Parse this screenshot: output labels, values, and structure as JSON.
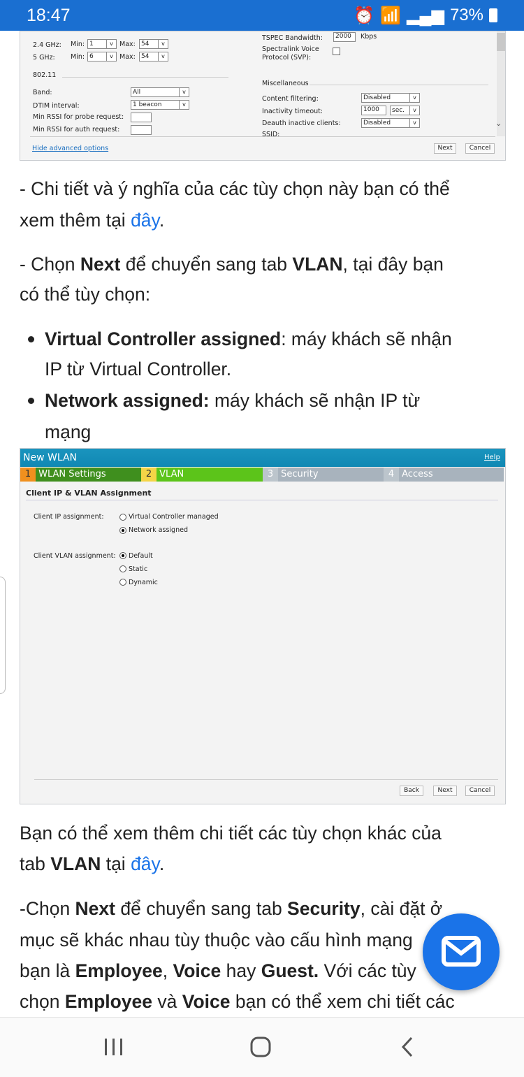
{
  "status_bar": {
    "time": "18:47",
    "battery": "73%"
  },
  "shot1": {
    "rates": [
      {
        "band": "2.4 GHz:",
        "min_label": "Min:",
        "min": "1",
        "max_label": "Max:",
        "max": "54"
      },
      {
        "band": "5 GHz:",
        "min_label": "Min:",
        "min": "6",
        "max_label": "Max:",
        "max": "54"
      }
    ],
    "section_80211": "802.11",
    "band_label": "Band:",
    "band_value": "All",
    "dtim_label": "DTIM interval:",
    "dtim_value": "1 beacon",
    "rssi_probe_label": "Min RSSI for probe request:",
    "rssi_auth_label": "Min RSSI for auth request:",
    "tspec_label": "TSPEC Bandwidth:",
    "tspec_value": "2000",
    "tspec_unit": "Kbps",
    "svp_label_1": "Spectralink Voice",
    "svp_label_2": "Protocol (SVP):",
    "misc": "Miscellaneous",
    "content_filter_label": "Content filtering:",
    "content_filter_value": "Disabled",
    "inactivity_label": "Inactivity timeout:",
    "inactivity_value": "1000",
    "inactivity_unit": "sec.",
    "deauth_label": "Deauth inactive clients:",
    "deauth_value": "Disabled",
    "ssid_label": "SSID:",
    "hide_advanced": "Hide advanced options",
    "next": "Next",
    "cancel": "Cancel"
  },
  "para1": [
    [
      {
        "t": "- Chi tiết và ý nghĩa của các tùy chọn này bạn có thể"
      }
    ],
    [
      {
        "t": "xem thêm tại "
      },
      {
        "t": "đây",
        "link": true
      },
      {
        "t": "."
      }
    ]
  ],
  "para2": [
    [
      {
        "t": "- Chọn "
      },
      {
        "t": "Next",
        "b": true
      },
      {
        "t": " để chuyển sang tab "
      },
      {
        "t": "VLAN",
        "b": true
      },
      {
        "t": ", tại đây bạn"
      }
    ],
    [
      {
        "t": "có thể tùy chọn:"
      }
    ]
  ],
  "bullets": [
    [
      {
        "t": "Virtual Controller assigned",
        "b": true
      },
      {
        "t": ": máy khách sẽ nhận"
      }
    ],
    [
      {
        "t": "IP từ Virtual Controller."
      }
    ],
    [
      {
        "t": "Network assigned:",
        "b": true
      },
      {
        "t": " máy khách sẽ nhận IP từ"
      }
    ],
    [
      {
        "t": "mạng"
      }
    ]
  ],
  "shot2": {
    "title": "New WLAN",
    "help": "Help",
    "tabs": [
      {
        "n": "1",
        "label": "WLAN Settings"
      },
      {
        "n": "2",
        "label": "VLAN"
      },
      {
        "n": "3",
        "label": "Security"
      },
      {
        "n": "4",
        "label": "Access"
      }
    ],
    "heading": "Client IP & VLAN Assignment",
    "ip_label": "Client IP assignment:",
    "ip_options": [
      {
        "label": "Virtual Controller managed",
        "selected": false
      },
      {
        "label": "Network assigned",
        "selected": true
      }
    ],
    "vlan_label": "Client VLAN assignment:",
    "vlan_options": [
      {
        "label": "Default",
        "selected": true
      },
      {
        "label": "Static",
        "selected": false
      },
      {
        "label": "Dynamic",
        "selected": false
      }
    ],
    "back": "Back",
    "next": "Next",
    "cancel": "Cancel"
  },
  "para3": [
    [
      {
        "t": " Bạn có thể xem thêm chi tiết các tùy chọn khác của"
      }
    ],
    [
      {
        "t": "tab "
      },
      {
        "t": "VLAN",
        "b": true
      },
      {
        "t": " tại "
      },
      {
        "t": "đây",
        "link": true
      },
      {
        "t": "."
      }
    ]
  ],
  "para4": [
    [
      {
        "t": "-Chọn "
      },
      {
        "t": "Next",
        "b": true
      },
      {
        "t": " để chuyển sang tab "
      },
      {
        "t": "Security",
        "b": true
      },
      {
        "t": ", cài đặt ở"
      }
    ],
    [
      {
        "t": "mục sẽ khác nhau tùy thuộc vào cấu hình mạng"
      }
    ],
    [
      {
        "t": "bạn là "
      },
      {
        "t": "Employee",
        "b": true
      },
      {
        "t": ", "
      },
      {
        "t": "Voice",
        "b": true
      },
      {
        "t": " hay "
      },
      {
        "t": "Guest.",
        "b": true
      },
      {
        "t": " Với các tùy"
      }
    ],
    [
      {
        "t": "chọn "
      },
      {
        "t": "Employee",
        "b": true
      },
      {
        "t": " và "
      },
      {
        "t": "Voice",
        "b": true
      },
      {
        "t": " bạn có thể xem chi tiết các"
      }
    ]
  ],
  "colors": {
    "status_bar": "#1a6fd1",
    "link": "#1a73e8",
    "fab": "#1a73e8",
    "wlan_header": "#1591b8",
    "tab_done": "#3f8f1e",
    "tab_active": "#5cc41a",
    "tab_pending": "#a8b3bd"
  }
}
